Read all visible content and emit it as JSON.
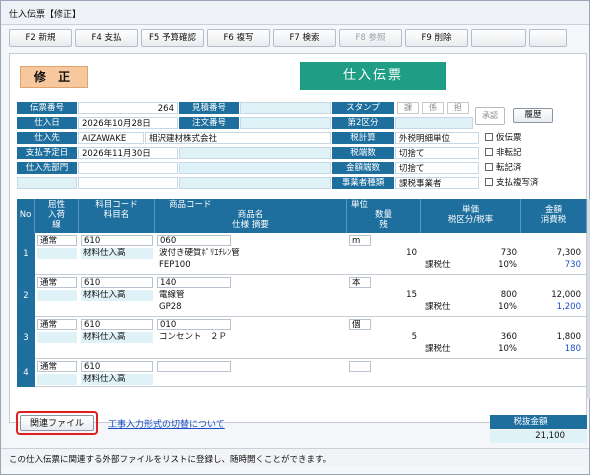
{
  "window": {
    "title": "仕入伝票【修正】"
  },
  "toolbar": [
    {
      "label": "F2 新規",
      "enabled": true
    },
    {
      "label": "F4 支払",
      "enabled": true
    },
    {
      "label": "F5 予算確認",
      "enabled": true
    },
    {
      "label": "F6 複写",
      "enabled": true
    },
    {
      "label": "F7 検索",
      "enabled": true
    },
    {
      "label": "F8 参照",
      "enabled": false
    },
    {
      "label": "F9 削除",
      "enabled": true
    }
  ],
  "mode_badge": "修 正",
  "doc_title": "仕入伝票",
  "header": {
    "labels": {
      "slip_no": "伝票番号",
      "date": "仕入日",
      "supplier": "仕入先",
      "pay_date": "支払予定日",
      "dept": "仕入先部門",
      "estimate_no": "見積番号",
      "order_no": "注文番号",
      "stamp": "スタンプ",
      "category2": "第2区分",
      "tax_calc": "税計算",
      "tax_rounding": "税端数",
      "amount_rounding": "金額端数",
      "business_type": "事業者種類"
    },
    "values": {
      "slip_no": "264",
      "date": "2026年10月28日",
      "supplier_code": "AIZAWAKE",
      "supplier_name": "相沢建材株式会社",
      "pay_date": "2026年11月30日",
      "tax_calc": "外税明細単位",
      "tax_rounding": "切捨て",
      "amount_rounding": "切捨て",
      "business_type": "課税事業者"
    },
    "stamps": [
      "課",
      "係",
      "担"
    ],
    "approve": "承認",
    "history_button": "履歴",
    "checkboxes": [
      "仮伝票",
      "非転記",
      "転記済",
      "支払複写済"
    ]
  },
  "grid": {
    "headers": {
      "no": "No",
      "attr": [
        "屈性",
        "入荷",
        "線"
      ],
      "subject_code": "科目コード",
      "subject_name": "科目名",
      "product_code": "商品コード",
      "product_name": "商品名",
      "spec": "仕様 摘要",
      "unit": "単位",
      "qty": "数量",
      "remain": "残",
      "price": "単価",
      "tax_rate": "税区分/税率",
      "amount": "金額",
      "tax": "消費税"
    },
    "rows": [
      {
        "no": "1",
        "attr": "通常",
        "subject_code": "610",
        "subject_name": "材料仕入高",
        "product_code": "060",
        "product_name": "波付き硬質ﾎﾟﾘｴﾁﾚﾝ管",
        "spec": "FEP100",
        "unit": "m",
        "qty": "10",
        "price": "730",
        "tax_class": "課税仕",
        "tax_rate": "10%",
        "amount": "7,300",
        "tax": "730"
      },
      {
        "no": "2",
        "attr": "通常",
        "subject_code": "610",
        "subject_name": "材料仕入高",
        "product_code": "140",
        "product_name": "電線管",
        "spec": "GP28",
        "unit": "本",
        "qty": "15",
        "price": "800",
        "tax_class": "課税仕",
        "tax_rate": "10%",
        "amount": "12,000",
        "tax": "1,200"
      },
      {
        "no": "3",
        "attr": "通常",
        "subject_code": "610",
        "subject_name": "材料仕入高",
        "product_code": "010",
        "product_name": "コンセント　２Ｐ",
        "spec": "",
        "unit": "個",
        "qty": "5",
        "price": "360",
        "tax_class": "課税仕",
        "tax_rate": "10%",
        "amount": "1,800",
        "tax": "180"
      },
      {
        "no": "4",
        "attr": "通常",
        "subject_code": "610",
        "subject_name": "材料仕入高",
        "product_code": "",
        "product_name": "",
        "spec": "",
        "unit": "",
        "qty": "",
        "price": "",
        "tax_class": "課税仕",
        "tax_rate": "10%",
        "amount": "",
        "tax": ""
      }
    ]
  },
  "footer": {
    "related_files_button": "関連ファイル",
    "link": "工事入力形式の切替について",
    "total_label": "税抜金額",
    "total_value": "21,100"
  },
  "status_bar": "この仕入伝票に関連する外部ファイルをリストに登録し、随時開くことができます。"
}
